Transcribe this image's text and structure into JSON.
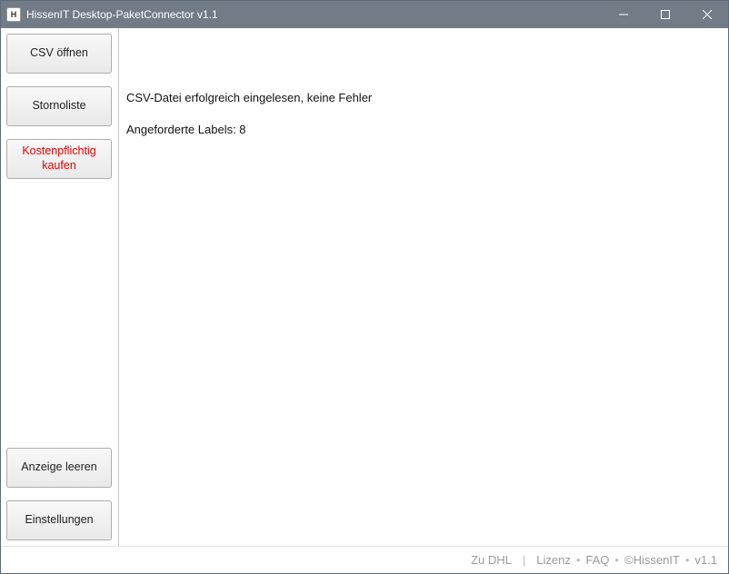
{
  "window": {
    "title": "HissenIT Desktop-PaketConnector v1.1"
  },
  "sidebar": {
    "open_csv_label": "CSV öffnen",
    "storno_label": "Stornoliste",
    "buy_label": "Kostenpflichtig kaufen",
    "clear_label": "Anzeige leeren",
    "settings_label": "Einstellungen"
  },
  "content": {
    "status_line1": "CSV-Datei erfolgreich eingelesen, keine Fehler",
    "status_line2": "Angeforderte Labels: 8"
  },
  "footer": {
    "dhl": "Zu DHL",
    "pipe": "|",
    "license": "Lizenz",
    "dot": "•",
    "faq": "FAQ",
    "copyright": "©HissenIT",
    "version": "v1.1"
  }
}
